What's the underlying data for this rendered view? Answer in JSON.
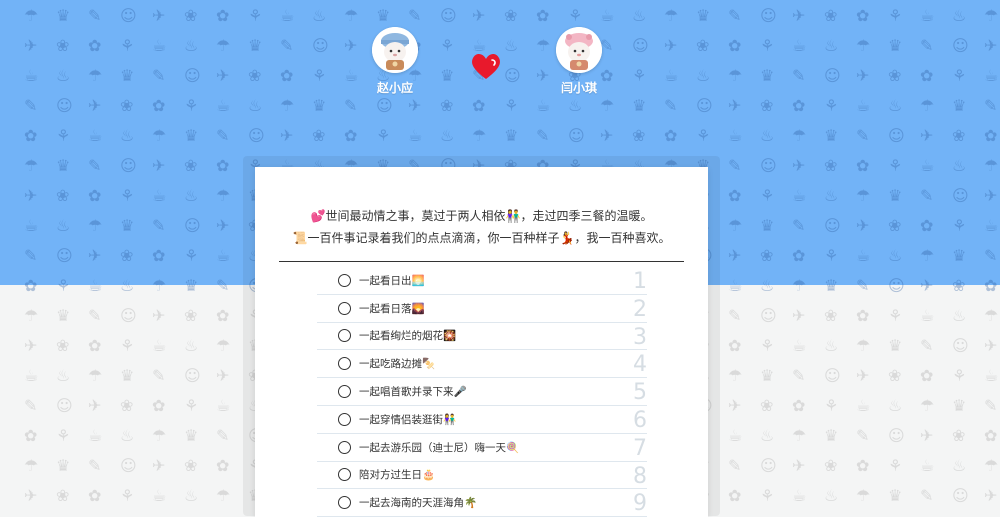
{
  "header": {
    "left_name": "赵小应",
    "right_name": "闫小琪",
    "left_avatar_icon": "boy-bear-avatar-icon",
    "right_avatar_icon": "girl-bear-avatar-icon",
    "heart_icon": "heart-icon"
  },
  "intro": {
    "line1_icon": "💕",
    "line1_text": "世间最动情之事，莫过于两人相依",
    "line1_icon2": "👫",
    "line1_text2": "，走过四季三餐的温暖。",
    "line2_icon": "📜",
    "line2_text": "一百件事记录着我们的点点滴滴，你一百种样子",
    "line2_icon2": "💃",
    "line2_text2": "，我一百种喜欢。"
  },
  "items": [
    {
      "text": "一起看日出🌅",
      "num": "1"
    },
    {
      "text": "一起看日落🌄",
      "num": "2"
    },
    {
      "text": "一起看绚烂的烟花🎇",
      "num": "3"
    },
    {
      "text": "一起吃路边摊🍢",
      "num": "4"
    },
    {
      "text": "一起唱首歌并录下来🎤",
      "num": "5"
    },
    {
      "text": "一起穿情侣装逛街👫",
      "num": "6"
    },
    {
      "text": "一起去游乐园（迪士尼）嗨一天🍭",
      "num": "7"
    },
    {
      "text": "陪对方过生日🎂",
      "num": "8"
    },
    {
      "text": "一起去海南的天涯海角🌴",
      "num": "9"
    }
  ],
  "colors": {
    "top_band": "#72b3f7",
    "bottom_band": "#f4f5f5",
    "heart": "#e8192c",
    "number": "#d6dde3"
  }
}
